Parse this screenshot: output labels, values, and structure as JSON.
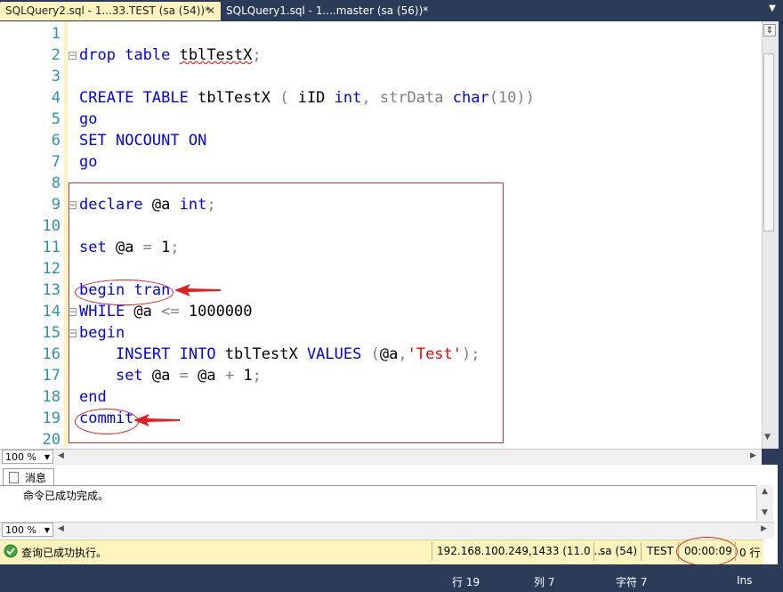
{
  "tabs": {
    "active": "SQLQuery2.sql - 1...33.TEST (sa (54))*",
    "inactive": "SQLQuery1.sql - 1....master (sa (56))*",
    "close_glyph": "✕"
  },
  "editor": {
    "line_numbers": [
      "1",
      "2",
      "3",
      "4",
      "5",
      "6",
      "7",
      "8",
      "9",
      "10",
      "11",
      "12",
      "13",
      "14",
      "15",
      "16",
      "17",
      "18",
      "19",
      "20"
    ],
    "lines": {
      "l2": [
        "drop",
        " ",
        "table",
        " ",
        "tblTestX",
        ";"
      ],
      "l4": [
        "CREATE",
        " ",
        "TABLE",
        " tblTestX ",
        "(",
        " iID ",
        "int",
        ", strData ",
        "char",
        "(10))"
      ],
      "l5": [
        "go"
      ],
      "l6": [
        "SET",
        " ",
        "NOCOUNT",
        " ",
        "ON"
      ],
      "l7": [
        "go"
      ],
      "l9": [
        "declare",
        " @a ",
        "int",
        ";"
      ],
      "l11": [
        "set",
        " @a ",
        "=",
        " 1",
        ";"
      ],
      "l13": [
        "begin",
        " ",
        "tran"
      ],
      "l14": [
        "WHILE",
        " @a ",
        "<=",
        " 1000000"
      ],
      "l15": [
        "begin"
      ],
      "l16": [
        "    ",
        "INSERT",
        " ",
        "INTO",
        " tblTestX ",
        "VALUES",
        " ",
        "(",
        "@a",
        ",",
        "'Test'",
        ");"
      ],
      "l17": [
        "    ",
        "set",
        " @a ",
        "=",
        " @a ",
        "+",
        " 1",
        ";"
      ],
      "l18": [
        "end"
      ],
      "l19": [
        "commit"
      ]
    },
    "fold_glyph": "⊟"
  },
  "zoom_editor": "100 %",
  "zoom_messages": "100 %",
  "messages": {
    "tab_label": "消息",
    "text": "命令已成功完成。"
  },
  "query_status": {
    "message": "查询已成功执行。",
    "server": "192.168.100.249,1433 (11.0 ...",
    "user": "sa (54)",
    "database": "TEST",
    "elapsed": "00:00:09",
    "rows": "0 行"
  },
  "status_bar": {
    "line": "行 19",
    "col": "列 7",
    "char": "字符 7",
    "mode": "Ins"
  },
  "colors": {
    "keyword": "#0000ff",
    "string": "#ff0000",
    "operator": "#808080",
    "line_number": "#2b91af",
    "annotation": "#d02020"
  }
}
